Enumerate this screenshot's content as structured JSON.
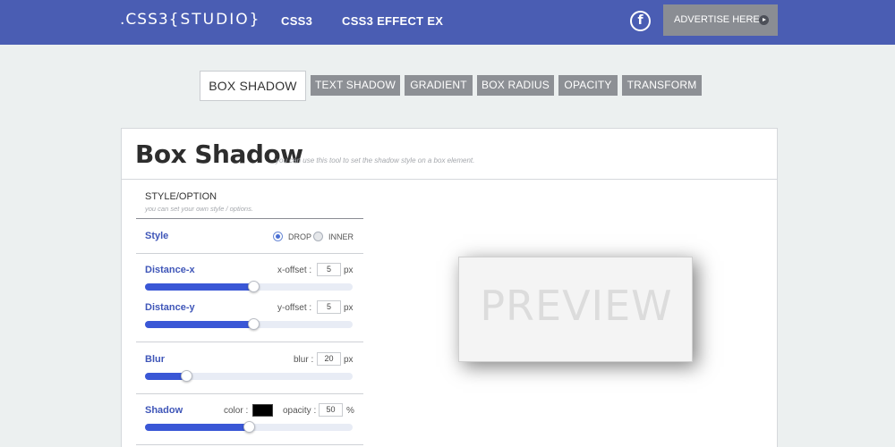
{
  "header": {
    "logo_main": ".CSS3",
    "logo_sub": "{STUDIO}",
    "nav": [
      "CSS3",
      "CSS3 EFFECT EX"
    ],
    "facebook_glyph": "f",
    "advertise_label": "ADVERTISE HERE",
    "colors": {
      "bar": "#4a5db3",
      "advertise": "#8a8d93"
    }
  },
  "tabs": [
    {
      "label": "BOX SHADOW",
      "active": true
    },
    {
      "label": "TEXT SHADOW",
      "active": false
    },
    {
      "label": "GRADIENT",
      "active": false
    },
    {
      "label": "BOX RADIUS",
      "active": false
    },
    {
      "label": "OPACITY",
      "active": false
    },
    {
      "label": "TRANSFORM",
      "active": false
    }
  ],
  "panel": {
    "title": "Box Shadow",
    "subtitle": "you can use this tool to set the shadow style on a box element."
  },
  "options": {
    "title": "STYLE/OPTION",
    "subtitle": "you can set your own style / options.",
    "style": {
      "label": "Style",
      "drop": "DROP",
      "inner": "INNER",
      "selected": "DROP"
    },
    "distance_x": {
      "label": "Distance-x",
      "field_label": "x-offset :",
      "value": "5",
      "unit": "px",
      "slider_fraction": 0.52
    },
    "distance_y": {
      "label": "Distance-y",
      "field_label": "y-offset :",
      "value": "5",
      "unit": "px",
      "slider_fraction": 0.52
    },
    "blur": {
      "label": "Blur",
      "field_label": "blur :",
      "value": "20",
      "unit": "px",
      "slider_fraction": 0.2
    },
    "shadow": {
      "label": "Shadow",
      "color_label": "color :",
      "color": "#000000",
      "opacity_label": "opacity :",
      "opacity_value": "50",
      "opacity_unit": "%",
      "slider_fraction": 0.5
    }
  },
  "preview": {
    "text": "PREVIEW"
  }
}
